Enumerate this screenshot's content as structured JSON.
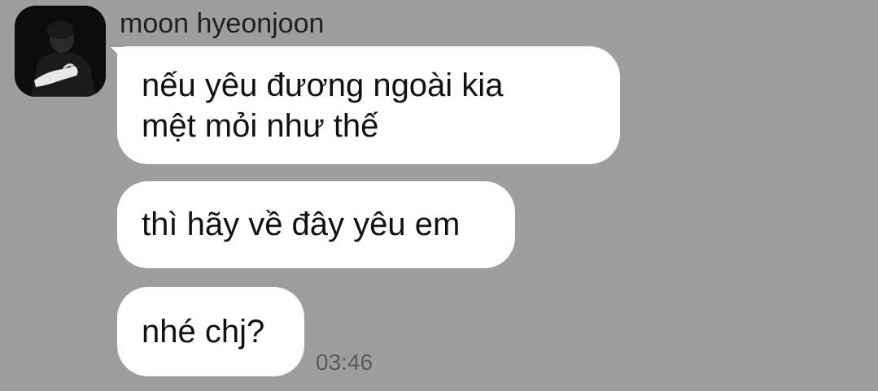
{
  "chat": {
    "sender_name": "moon hyeonjoon",
    "avatar_icon": "profile-photo-avatar",
    "messages": [
      {
        "lines": [
          "nếu yêu đương ngoài kia",
          "mệt mỏi như thế"
        ]
      },
      {
        "lines": [
          "thì hãy về đây yêu em"
        ]
      },
      {
        "lines": [
          "nhé chj?"
        ]
      }
    ],
    "timestamp": "03:46"
  },
  "colors": {
    "background": "#9e9e9e",
    "bubble": "#ffffff",
    "text": "#111111",
    "timestamp": "#5b5b5b"
  }
}
